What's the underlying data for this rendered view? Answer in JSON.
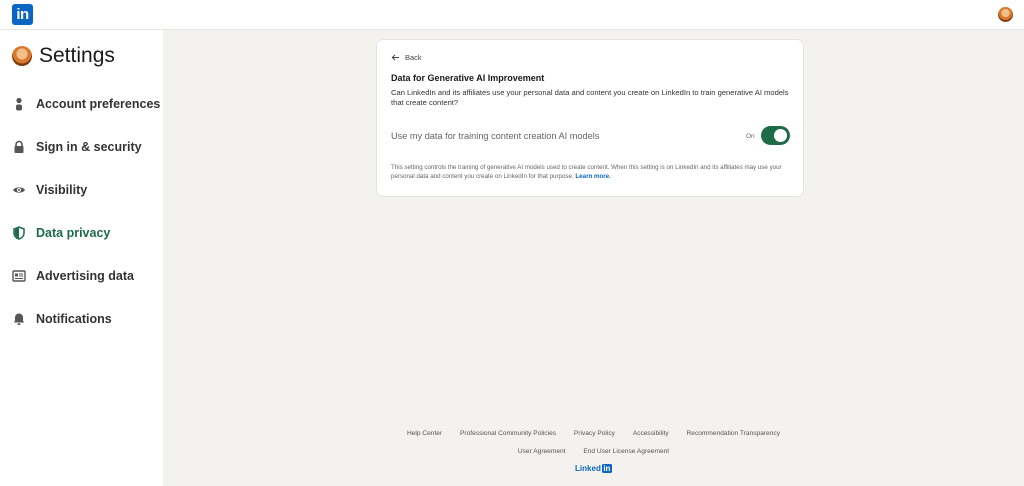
{
  "topbar": {
    "logo_text": "in"
  },
  "sidebar": {
    "title": "Settings",
    "items": [
      {
        "label": "Account preferences",
        "icon": "person-icon"
      },
      {
        "label": "Sign in & security",
        "icon": "lock-icon"
      },
      {
        "label": "Visibility",
        "icon": "eye-icon"
      },
      {
        "label": "Data privacy",
        "icon": "shield-icon",
        "active": true
      },
      {
        "label": "Advertising data",
        "icon": "newspaper-icon"
      },
      {
        "label": "Notifications",
        "icon": "bell-icon"
      }
    ]
  },
  "card": {
    "back_label": "Back",
    "title": "Data for Generative AI Improvement",
    "description": "Can LinkedIn and its affiliates use your personal data and content you create on LinkedIn to train generative AI models that create content?",
    "setting_label": "Use my data for training content creation AI models",
    "toggle_state_label": "On",
    "toggle_on": true,
    "note": "This setting controls the training of generative AI models used to create content. When this setting is on LinkedIn and its affiliates may use your personal data and content you create on LinkedIn for that purpose.",
    "learn_more": "Learn more."
  },
  "footer": {
    "row1": [
      "Help Center",
      "Professional Community Policies",
      "Privacy Policy",
      "Accessibility",
      "Recommendation Transparency"
    ],
    "row2": [
      "User Agreement",
      "End User License Agreement"
    ],
    "logo_text": "Linked",
    "logo_in": "in"
  },
  "colors": {
    "accent_green": "#1e6a49",
    "brand_blue": "#0a66c2",
    "background": "#f4f2ee"
  }
}
